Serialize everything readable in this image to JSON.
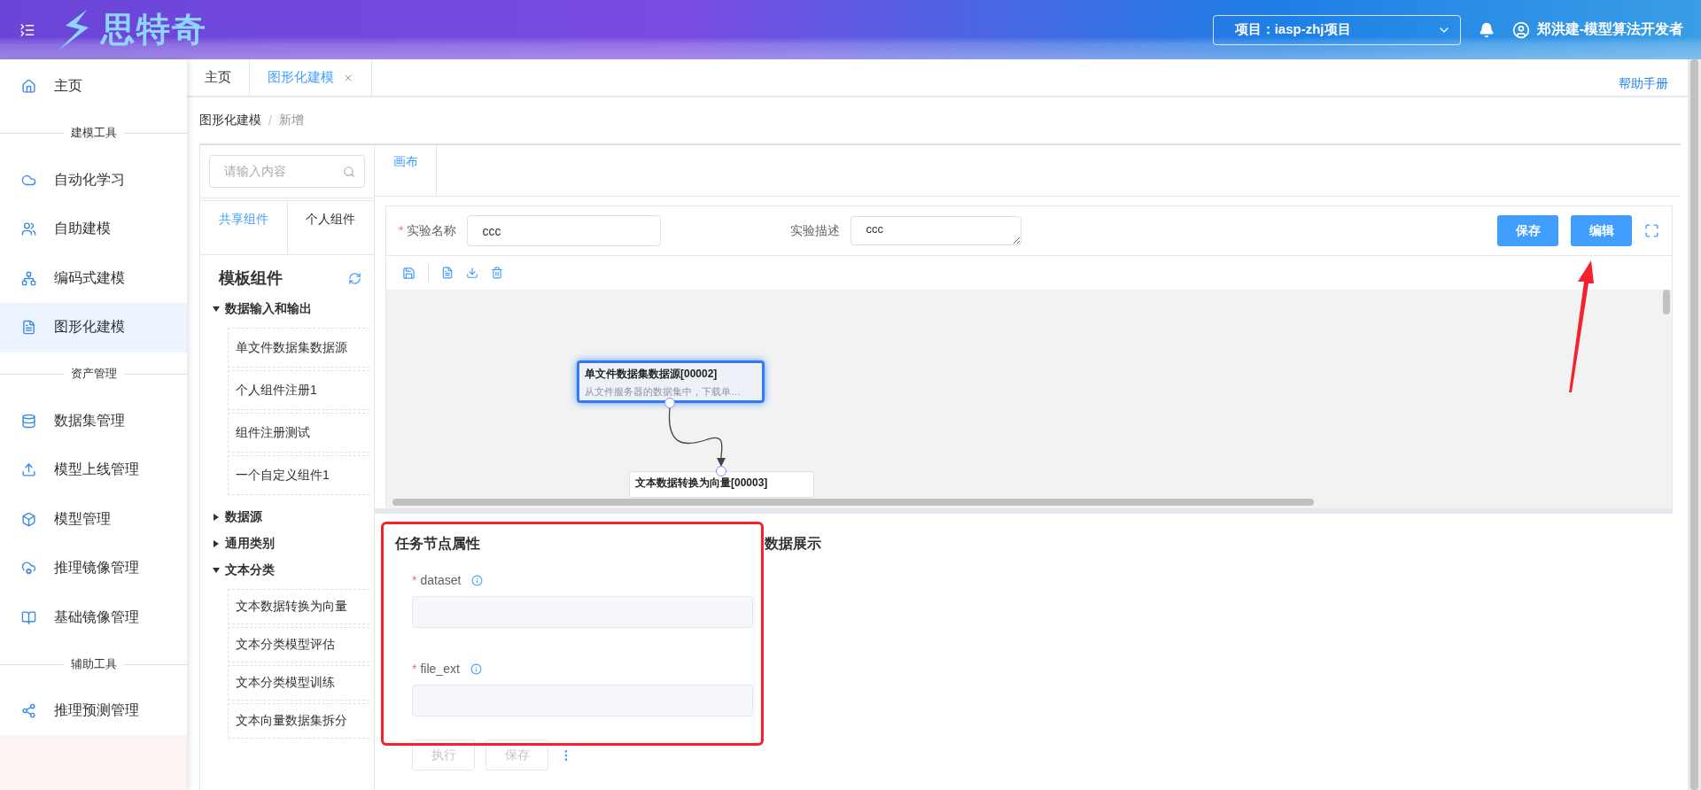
{
  "header": {
    "logo_text": "思特奇",
    "project_select": {
      "value": "项目：iasp-zhj项目"
    },
    "user_name": "郑洪建-模型算法开发者"
  },
  "sidebar": {
    "items": [
      {
        "kind": "item",
        "label": "主页",
        "selected": false
      },
      {
        "kind": "section",
        "label": "建模工具"
      },
      {
        "kind": "item",
        "label": "自动化学习",
        "selected": false
      },
      {
        "kind": "item",
        "label": "自助建模",
        "selected": false
      },
      {
        "kind": "item",
        "label": "编码式建模",
        "selected": false
      },
      {
        "kind": "item",
        "label": "图形化建模",
        "selected": true
      },
      {
        "kind": "section",
        "label": "资产管理"
      },
      {
        "kind": "item",
        "label": "数据集管理",
        "selected": false
      },
      {
        "kind": "item",
        "label": "模型上线管理",
        "selected": false
      },
      {
        "kind": "item",
        "label": "模型管理",
        "selected": false
      },
      {
        "kind": "item",
        "label": "推理镜像管理",
        "selected": false
      },
      {
        "kind": "item",
        "label": "基础镜像管理",
        "selected": false
      },
      {
        "kind": "section",
        "label": "辅助工具"
      },
      {
        "kind": "item",
        "label": "推理预测管理",
        "selected": false
      }
    ]
  },
  "tabs": [
    {
      "label": "主页",
      "selected": false,
      "closable": false
    },
    {
      "label": "图形化建模",
      "selected": true,
      "closable": true
    }
  ],
  "help_link": "帮助手册",
  "breadcrumb": {
    "items": [
      "图形化建模",
      "新增"
    ],
    "separator": "/"
  },
  "components_panel": {
    "search": {
      "placeholder": "请输入内容"
    },
    "tabs": [
      {
        "label": "共享组件",
        "selected": true
      },
      {
        "label": "个人组件",
        "selected": false
      }
    ],
    "title": "模板组件",
    "groups": [
      {
        "label": "数据输入和输出",
        "expanded": true,
        "children": [
          {
            "label": "单文件数据集数据源"
          },
          {
            "label": "个人组件注册1"
          },
          {
            "label": "组件注册测试"
          },
          {
            "label": "一个自定义组件1"
          }
        ]
      },
      {
        "label": "数据源",
        "expanded": false
      },
      {
        "label": "通用类别",
        "expanded": false
      },
      {
        "label": "文本分类",
        "expanded": true,
        "children": [
          {
            "label": "文本数据转换为向量"
          },
          {
            "label": "文本分类模型评估"
          },
          {
            "label": "文本分类模型训练"
          },
          {
            "label": "文本向量数据集拆分"
          }
        ]
      }
    ]
  },
  "canvas_panel": {
    "tabs": [
      {
        "label": "画布",
        "selected": true
      }
    ],
    "form": {
      "name_label": "实验名称",
      "name_required": true,
      "name_required_mark": "*",
      "name_value": "ccc",
      "desc_label": "实验描述",
      "desc_value": "ccc"
    },
    "buttons": [
      {
        "label": "保存"
      },
      {
        "label": "编辑"
      }
    ],
    "nodes": [
      {
        "title": "单文件数据集数据源[00002]",
        "description": "从文件服务器的数据集中，下载单…",
        "selected": true
      },
      {
        "title": "文本数据转换为向量[00003]",
        "selected": false
      }
    ]
  },
  "properties": {
    "title": "任务节点属性",
    "fields": [
      {
        "label": "dataset",
        "required": true,
        "required_mark": "*"
      },
      {
        "label": "file_ext",
        "required": true,
        "required_mark": "*"
      }
    ],
    "buttons": [
      {
        "label": "执行",
        "disabled": true
      },
      {
        "label": "保存",
        "disabled": true
      }
    ]
  },
  "data_display": {
    "title": "数据展示"
  }
}
